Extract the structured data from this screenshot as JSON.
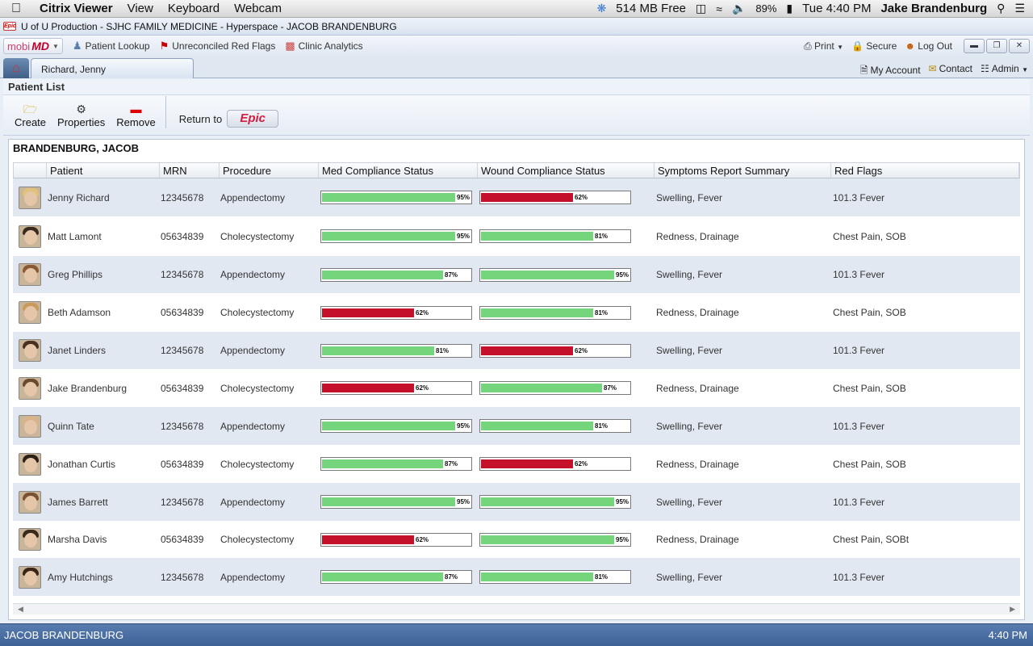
{
  "menubar": {
    "items": [
      "Citrix Viewer",
      "View",
      "Keyboard",
      "Webcam"
    ],
    "memory": "514 MB Free",
    "battery": "89%",
    "clock": "Tue 4:40 PM",
    "user": "Jake Brandenburg"
  },
  "window": {
    "title": "U of U Production - SJHC FAMILY MEDICINE - Hyperspace - JACOB BRANDENBURG"
  },
  "toolbar": {
    "mobimd_prefix": "mobi",
    "mobimd_suffix": "MD",
    "patient_lookup": "Patient Lookup",
    "unreconciled": "Unreconciled Red Flags",
    "analytics": "Clinic Analytics",
    "print": "Print",
    "secure": "Secure",
    "logout": "Log Out"
  },
  "tabs": {
    "patient_tab": "Richard, Jenny",
    "my_account": "My Account",
    "contact": "Contact",
    "admin": "Admin"
  },
  "panel": {
    "title": "Patient List",
    "create": "Create",
    "properties": "Properties",
    "remove": "Remove",
    "return_to": "Return to",
    "epic": "Epic",
    "section": "BRANDENBURG, JACOB"
  },
  "columns": [
    "",
    "Patient",
    "MRN",
    "Procedure",
    "Med Compliance Status",
    "Wound Compliance Status",
    "Symptoms Report Summary",
    "Red Flags"
  ],
  "accent_colors": {
    "good": "#74d57c",
    "bad": "#c5102b"
  },
  "patients": [
    {
      "name": "Jenny Richard",
      "mrn": "12345678",
      "procedure": "Appendectomy",
      "med": 95,
      "med_label": "95%",
      "wound": 62,
      "wound_label": "62%",
      "symptoms": "Swelling, Fever",
      "flags": "101.3 Fever",
      "hair": "#e2c27a"
    },
    {
      "name": "Matt Lamont",
      "mrn": "05634839",
      "procedure": "Cholecystectomy",
      "med": 95,
      "med_label": "95%",
      "wound": 81,
      "wound_label": "81%",
      "symptoms": "Redness, Drainage",
      "flags": "Chest Pain, SOB",
      "hair": "#3a2a1e"
    },
    {
      "name": "Greg Phillips",
      "mrn": "12345678",
      "procedure": "Appendectomy",
      "med": 87,
      "med_label": "87%",
      "wound": 95,
      "wound_label": "95%",
      "symptoms": "Swelling, Fever",
      "flags": "101.3 Fever",
      "hair": "#8a5a34"
    },
    {
      "name": "Beth Adamson",
      "mrn": "05634839",
      "procedure": "Cholecystectomy",
      "med": 62,
      "med_label": "62%",
      "wound": 81,
      "wound_label": "81%",
      "symptoms": "Redness, Drainage",
      "flags": "Chest Pain, SOB",
      "hair": "#c99a5c"
    },
    {
      "name": "Janet Linders",
      "mrn": "12345678",
      "procedure": "Appendectomy",
      "med": 81,
      "med_label": "81%",
      "wound": 62,
      "wound_label": "62%",
      "symptoms": "Swelling, Fever",
      "flags": "101.3 Fever",
      "hair": "#4a3020"
    },
    {
      "name": "Jake Brandenburg",
      "mrn": "05634839",
      "procedure": "Cholecystectomy",
      "med": 62,
      "med_label": "62%",
      "wound": 87,
      "wound_label": "87%",
      "symptoms": "Redness, Drainage",
      "flags": "Chest Pain, SOB",
      "hair": "#6b4a2e"
    },
    {
      "name": "Quinn Tate",
      "mrn": "12345678",
      "procedure": "Appendectomy",
      "med": 95,
      "med_label": "95%",
      "wound": 81,
      "wound_label": "81%",
      "symptoms": "Swelling, Fever",
      "flags": "101.3 Fever",
      "hair": "#d9b48a"
    },
    {
      "name": "Jonathan Curtis",
      "mrn": "05634839",
      "procedure": "Cholecystectomy",
      "med": 87,
      "med_label": "87%",
      "wound": 62,
      "wound_label": "62%",
      "symptoms": "Redness, Drainage",
      "flags": "Chest Pain, SOB",
      "hair": "#2d2016"
    },
    {
      "name": "James Barrett",
      "mrn": "12345678",
      "procedure": "Appendectomy",
      "med": 95,
      "med_label": "95%",
      "wound": 95,
      "wound_label": "95%",
      "symptoms": "Swelling, Fever",
      "flags": "101.3 Fever",
      "hair": "#7a5232"
    },
    {
      "name": "Marsha Davis",
      "mrn": "05634839",
      "procedure": "Cholecystectomy",
      "med": 62,
      "med_label": "62%",
      "wound": 95,
      "wound_label": "95%",
      "symptoms": "Redness, Drainage",
      "flags": "Chest Pain, SOBt",
      "hair": "#3b2a1c"
    },
    {
      "name": "Amy Hutchings",
      "mrn": "12345678",
      "procedure": "Appendectomy",
      "med": 87,
      "med_label": "87%",
      "wound": 81,
      "wound_label": "81%",
      "symptoms": "Swelling, Fever",
      "flags": "101.3 Fever",
      "hair": "#3a2518"
    }
  ],
  "status": {
    "user": "JACOB BRANDENBURG",
    "time": "4:40 PM"
  }
}
